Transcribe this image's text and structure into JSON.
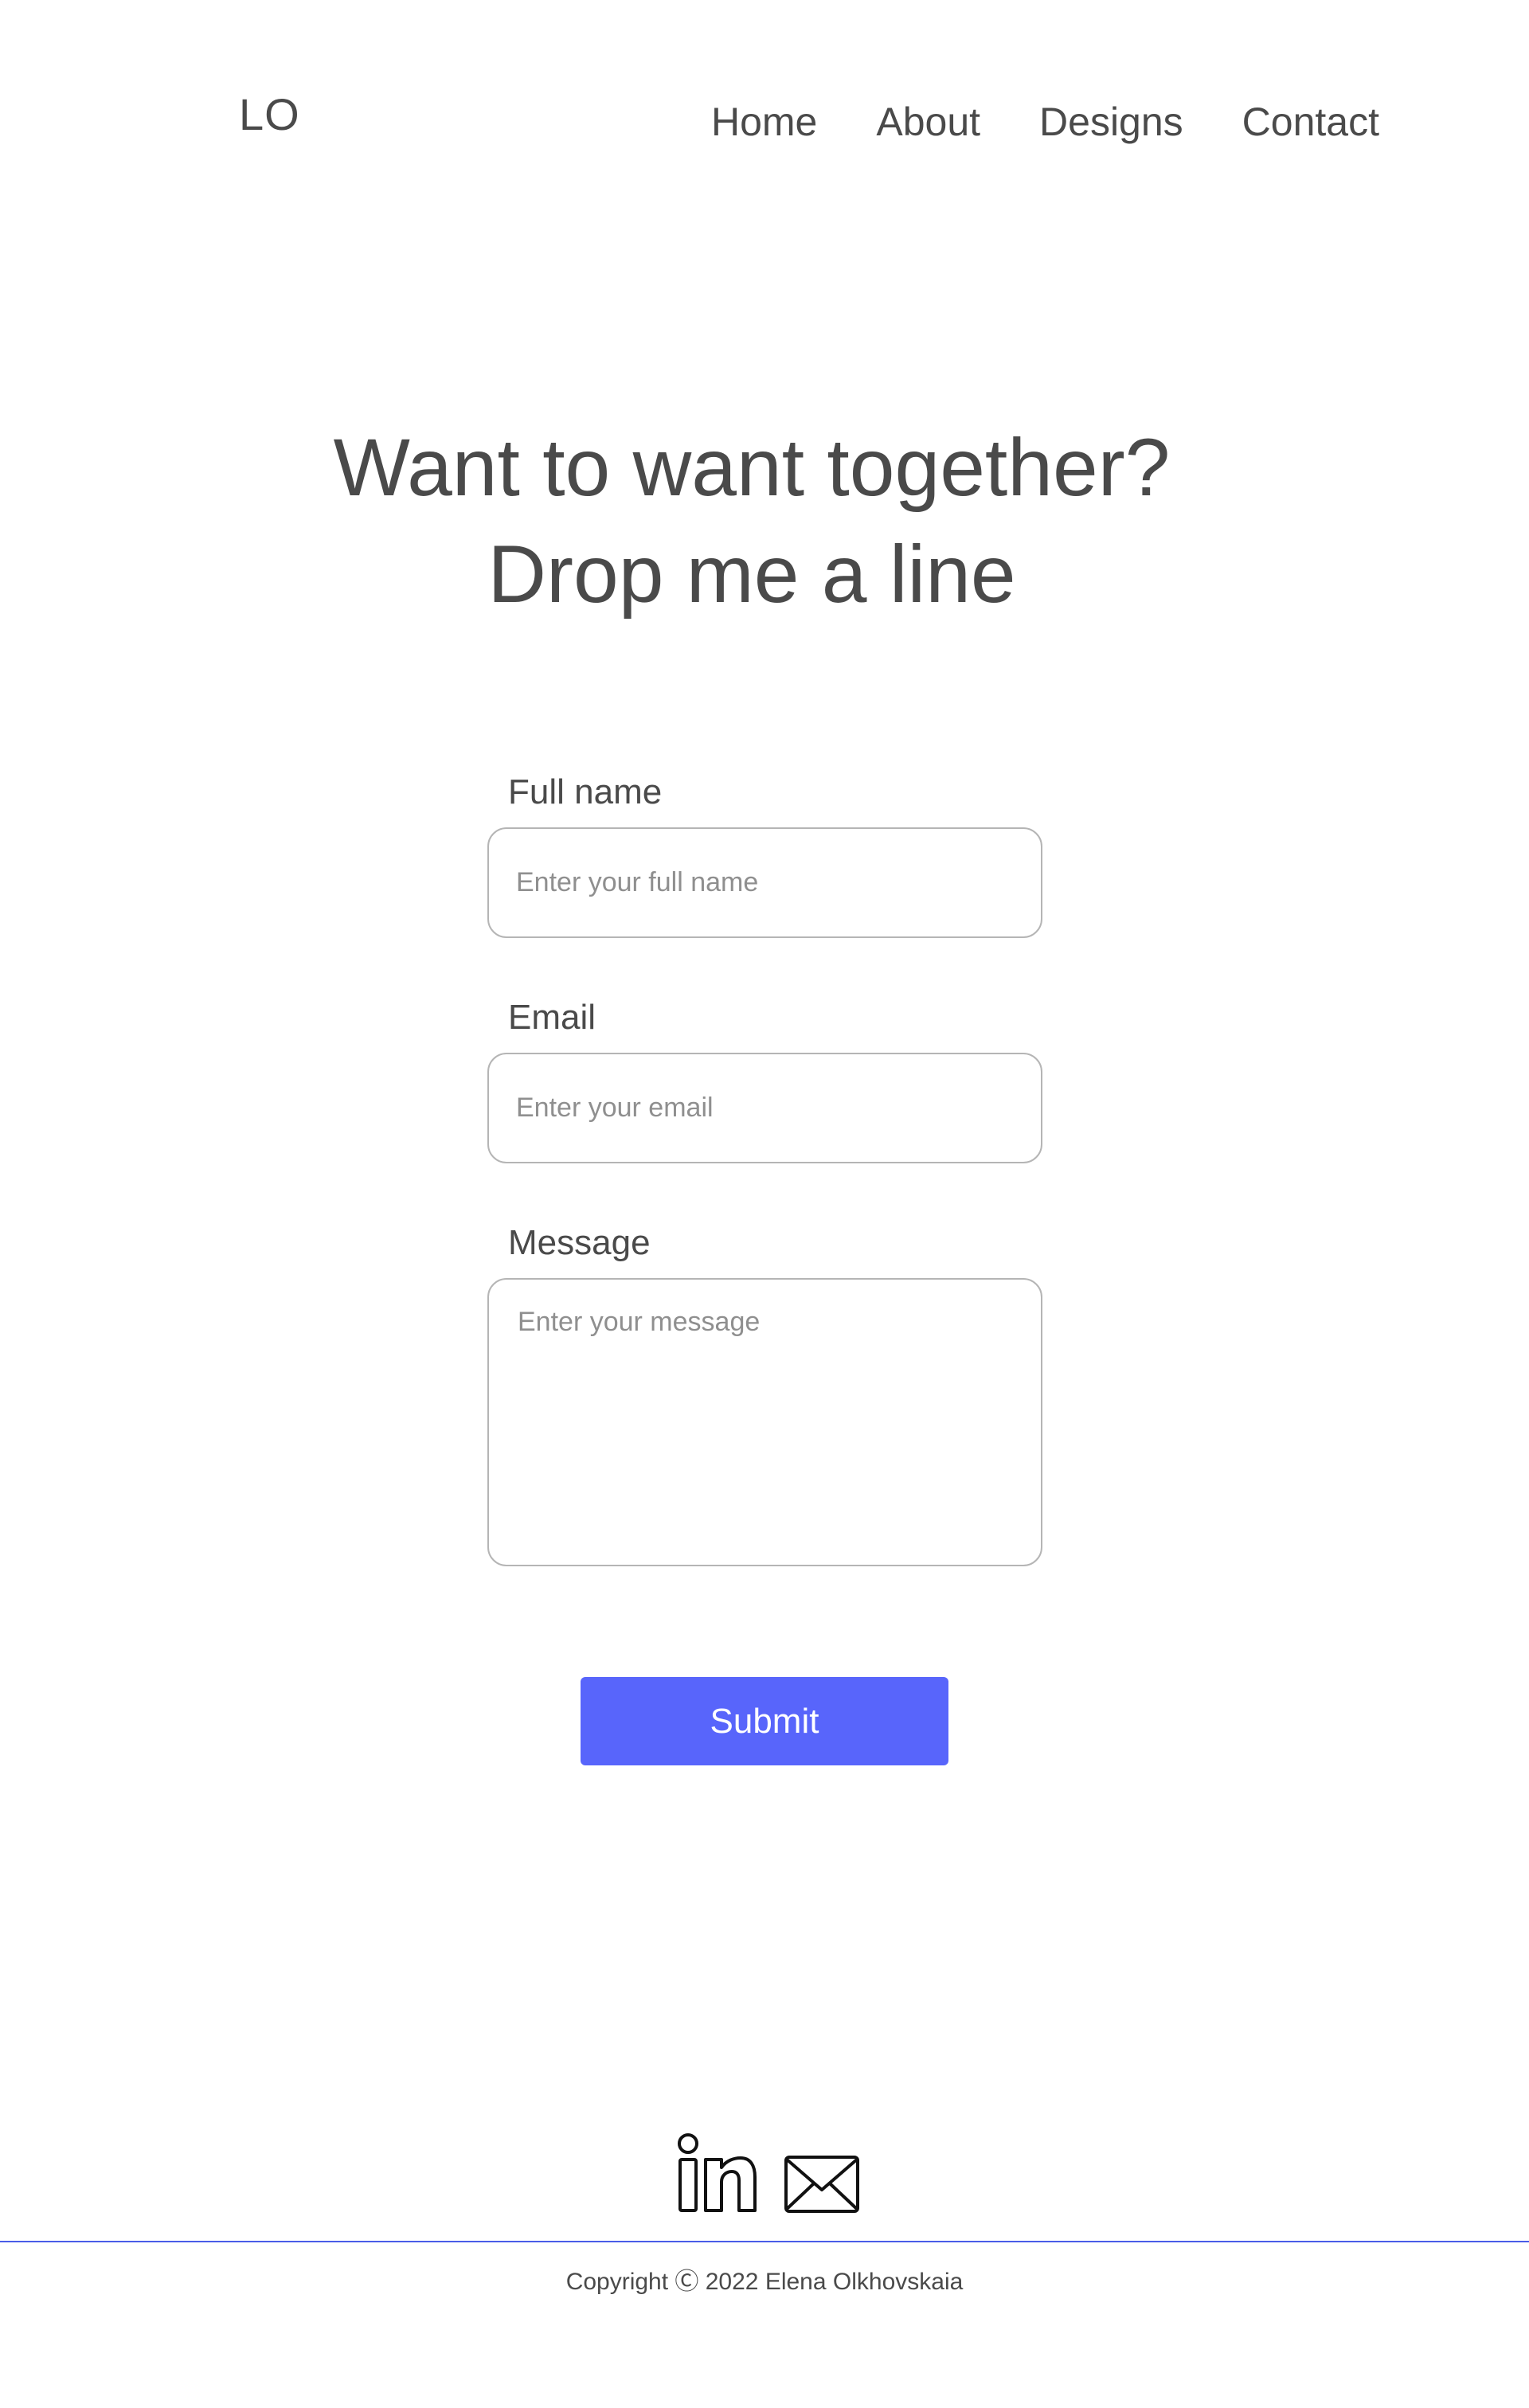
{
  "header": {
    "logo": "LO",
    "nav": [
      {
        "label": "Home"
      },
      {
        "label": "About"
      },
      {
        "label": "Designs"
      },
      {
        "label": "Contact"
      }
    ]
  },
  "hero": {
    "line1": "Want to want together?",
    "line2": "Drop me a line"
  },
  "form": {
    "name": {
      "label": "Full name",
      "placeholder": "Enter your full name",
      "value": ""
    },
    "email": {
      "label": "Email",
      "placeholder": "Enter your email",
      "value": ""
    },
    "message": {
      "label": "Message",
      "placeholder": "Enter your message",
      "value": ""
    },
    "submit_label": "Submit",
    "accent_color": "#5865fb"
  },
  "footer": {
    "social_icons": [
      "linkedin-icon",
      "mail-icon"
    ],
    "rule_color": "#4a5de8",
    "copyright": "Copyright Ⓒ 2022 Elena Olkhovskaia"
  }
}
